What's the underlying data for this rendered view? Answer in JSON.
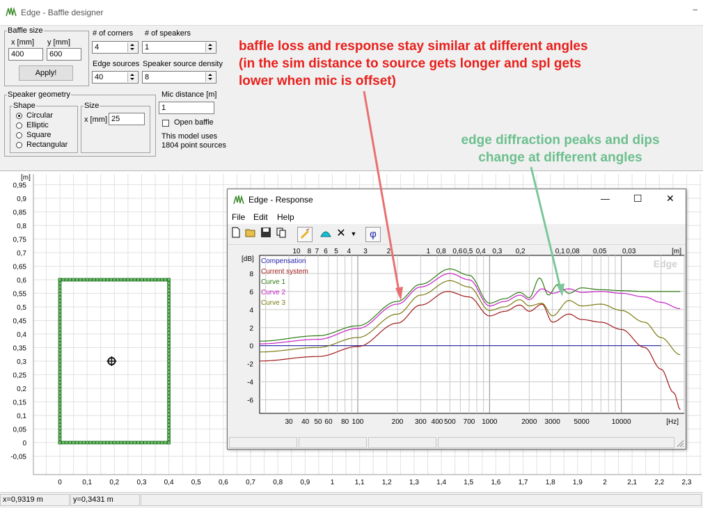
{
  "app": {
    "title": "Edge - Baffle designer",
    "min_glyph": "–"
  },
  "baffle_size": {
    "legend": "Baffle size",
    "x_label": "x [mm]",
    "y_label": "y [mm]",
    "x_value": "400",
    "y_value": "600",
    "apply_label": "Apply!"
  },
  "corners": {
    "label": "# of corners",
    "value": "4"
  },
  "speakers": {
    "label": "# of speakers",
    "value": "1"
  },
  "edge_sources": {
    "label": "Edge sources",
    "value": "40"
  },
  "density": {
    "label": "Speaker source density",
    "value": "8"
  },
  "geometry": {
    "legend": "Speaker geometry",
    "shape_legend": "Shape",
    "shapes": [
      "Circular",
      "Elliptic",
      "Square",
      "Rectangular"
    ],
    "selected_shape": "Circular",
    "size_legend": "Size",
    "size_label": "x [mm]",
    "size_value": "25"
  },
  "mic": {
    "label": "Mic distance [m]",
    "value": "1",
    "open_baffle_label": "Open baffle",
    "open_baffle_checked": false
  },
  "model_info": {
    "line1": "This model uses",
    "line2": "1804 point sources"
  },
  "annotations": {
    "red": [
      "baffle loss and response stay similar at different angles",
      "(in the sim distance to source gets longer and spl gets",
      "lower when mic is offset)"
    ],
    "green": [
      "edge diffraction peaks and dips",
      "change at different angles"
    ],
    "red_color": "#e8201c",
    "green_color": "#6cbf8e"
  },
  "baffle_plot": {
    "unit": "[m]",
    "y_ticks": [
      "0,95",
      "0,9",
      "0,85",
      "0,8",
      "0,75",
      "0,7",
      "0,65",
      "0,6",
      "0,55",
      "0,5",
      "0,45",
      "0,4",
      "0,35",
      "0,3",
      "0,25",
      "0,2",
      "0,15",
      "0,1",
      "0,05",
      "0",
      "-0,05"
    ],
    "x_ticks": [
      "0",
      "0,1",
      "0,2",
      "0,3",
      "0,4",
      "0,5",
      "0,6",
      "0,7",
      "0,8",
      "0,9",
      "1",
      "1,1",
      "1,2",
      "1,3",
      "1,4",
      "1,5",
      "1,6",
      "1,7",
      "1,8",
      "1,9",
      "2",
      "2,1",
      "2,2",
      "2,3"
    ],
    "baffle_width_m": 0.4,
    "baffle_height_m": 0.6,
    "speaker_x_m": 0.19,
    "speaker_y_m": 0.3
  },
  "status": {
    "x": "x=0,9319 m",
    "y": "y=0,3431 m"
  },
  "response_window": {
    "title": "Edge - Response",
    "menu": [
      "File",
      "Edit",
      "Help"
    ],
    "controls": {
      "minimize": "—",
      "maximize": "☐",
      "close": "✕"
    },
    "phi_label": "φ",
    "watermark": "Edge"
  },
  "chart_data": {
    "type": "line",
    "ylabel": "[dB]",
    "xlabel": "[Hz]",
    "top_axis_label": "[m]",
    "x_scale": "log",
    "xlim": [
      18,
      30000
    ],
    "ylim": [
      -7.5,
      10
    ],
    "y_ticks": [
      "8",
      "6",
      "4",
      "2",
      "0",
      "-2",
      "-4",
      "-6"
    ],
    "x_tick_labels": [
      "30",
      "40",
      "50",
      "60",
      "80",
      "100",
      "200",
      "300",
      "400",
      "500",
      "700",
      "1000",
      "2000",
      "3000",
      "5000",
      "10000"
    ],
    "top_tick_labels": [
      "10",
      "8",
      "7",
      "6",
      "5",
      "4",
      "3",
      "2",
      "1",
      "0,8",
      "0,6",
      "0,5",
      "0,4",
      "0,3",
      "0,2",
      "0,1",
      "0,08",
      "0,05",
      "0,03"
    ],
    "grid": true,
    "legend_position": "top-left",
    "series": [
      {
        "name": "Compensation",
        "color": "#1f1fa8",
        "x": [
          18,
          20000
        ],
        "y": [
          0,
          0
        ]
      },
      {
        "name": "Current system",
        "color": "#a01818",
        "x": [
          18,
          50,
          100,
          200,
          300,
          480,
          700,
          1000,
          1300,
          1700,
          2000,
          2500,
          3000,
          4000,
          5000,
          7000,
          10000,
          15000,
          20000,
          25000,
          28000
        ],
        "y": [
          -1.7,
          -1.2,
          -0.1,
          2.5,
          4.5,
          6.0,
          5.4,
          3.3,
          3.8,
          4.5,
          3.8,
          4.6,
          2.6,
          3.5,
          2.9,
          2.6,
          1.8,
          -0.2,
          -2.6,
          -5.2,
          -7.1
        ]
      },
      {
        "name": "Curve 1",
        "color": "#2b7a12",
        "x": [
          18,
          50,
          100,
          200,
          300,
          500,
          700,
          1000,
          1300,
          1700,
          2000,
          2400,
          2800,
          3300,
          4000,
          5000,
          7000,
          10000,
          15000,
          20000,
          28000
        ],
        "y": [
          0.5,
          1.1,
          2.2,
          4.9,
          6.8,
          8.5,
          7.8,
          4.7,
          5.2,
          5.9,
          5.3,
          7.5,
          5.6,
          6.8,
          5.8,
          6.4,
          6.2,
          6.1,
          6.0,
          6.0,
          6.0
        ]
      },
      {
        "name": "Curve 2",
        "color": "#c420c4",
        "x": [
          18,
          50,
          100,
          200,
          300,
          500,
          700,
          1000,
          1300,
          1700,
          2000,
          2500,
          3000,
          4000,
          5000,
          7000,
          10000,
          15000,
          20000,
          28000
        ],
        "y": [
          0.2,
          0.7,
          1.9,
          4.6,
          6.5,
          8.0,
          7.3,
          4.4,
          4.9,
          5.6,
          5.1,
          6.3,
          5.8,
          6.3,
          5.9,
          6.0,
          5.8,
          5.4,
          4.8,
          4.1
        ]
      },
      {
        "name": "Curve 3",
        "color": "#7a7a10",
        "x": [
          18,
          50,
          100,
          200,
          300,
          500,
          700,
          1000,
          1300,
          1700,
          2000,
          2500,
          3000,
          4000,
          5000,
          7000,
          10000,
          15000,
          20000,
          28000
        ],
        "y": [
          -0.7,
          -0.2,
          0.9,
          3.5,
          5.6,
          7.2,
          6.5,
          3.9,
          4.3,
          5.1,
          4.4,
          4.7,
          3.3,
          5.0,
          4.4,
          4.6,
          3.9,
          2.6,
          0.9,
          -1.0
        ]
      }
    ]
  }
}
